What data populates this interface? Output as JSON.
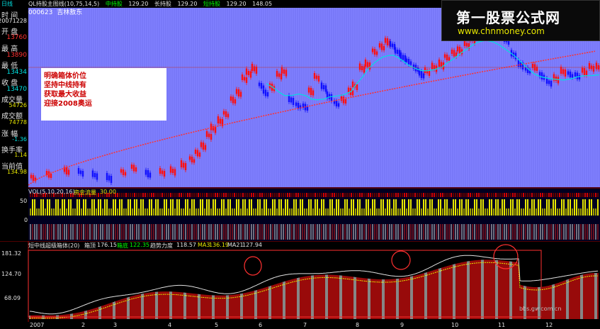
{
  "title_bar": {
    "period": "日线",
    "indicator": "QL持股主图线(10,75,14,5)",
    "mid_label": "中持股",
    "mid_value": "129.20",
    "long_label": "长持股",
    "long_value": "129.20",
    "short_label": "短持股",
    "short_value": "129.20",
    "extra_value": "148.05"
  },
  "stock": {
    "code": "000623",
    "name": "吉林敖东"
  },
  "left_panel": {
    "time_label": "时 间",
    "time_value": "20071228",
    "open_label": "开 盘",
    "open_value": "13760",
    "high_label": "最 高",
    "high_value": "13890",
    "low_label": "最 低",
    "low_value": "13434",
    "close_label": "收 盘",
    "close_value": "13470",
    "volume_label": "成交量",
    "volume_value": "54726",
    "amount_label": "成交额",
    "amount_value": "74778",
    "change_label": "涨 幅",
    "change_value": "-1.36",
    "turnover_label": "换手率",
    "turnover_value": "1.14",
    "current_label": "当前值",
    "current_value": "134.98"
  },
  "annotation": {
    "line1": "明确箱体价位",
    "line2": "坚持中线持有",
    "line3": "获取最大收益",
    "line4": "迎接2008奥运"
  },
  "logo": {
    "title": "第一股票公式网",
    "url": "www.chnmoney.com"
  },
  "vol_panel": {
    "header": "VOL(5,10,20,16)",
    "flow_label": "资金流量",
    "flow_value": "30.00",
    "tick_50": "50",
    "tick_0": "0"
  },
  "low_panel": {
    "header": "短中线超级箱体(20)",
    "box_top_label": "箱顶",
    "box_top_value": "176.15",
    "box_bottom_label": "箱底",
    "box_bottom_value": "122.35",
    "trend_label": "趋势力度",
    "trend_value": "118.57",
    "ma3_label": "MA3",
    "ma3_value": "136.19",
    "ma21_label": "MA21",
    "ma21_value": "127.94",
    "y_top": "181.32",
    "y_mid": "124.70",
    "y_low": "68.09",
    "watermark": "bbs.gw.com.cn"
  },
  "x_axis": [
    "2007",
    "2",
    "3",
    "4",
    "5",
    "6",
    "7",
    "8",
    "9",
    "10",
    "11",
    "12"
  ],
  "colors": {
    "chart_bg": "#8080ff",
    "up_candle": "#ff0000",
    "down_candle": "#0000ff",
    "ma_fast": "#00e0e0",
    "ma_slow": "#ff3030"
  }
}
